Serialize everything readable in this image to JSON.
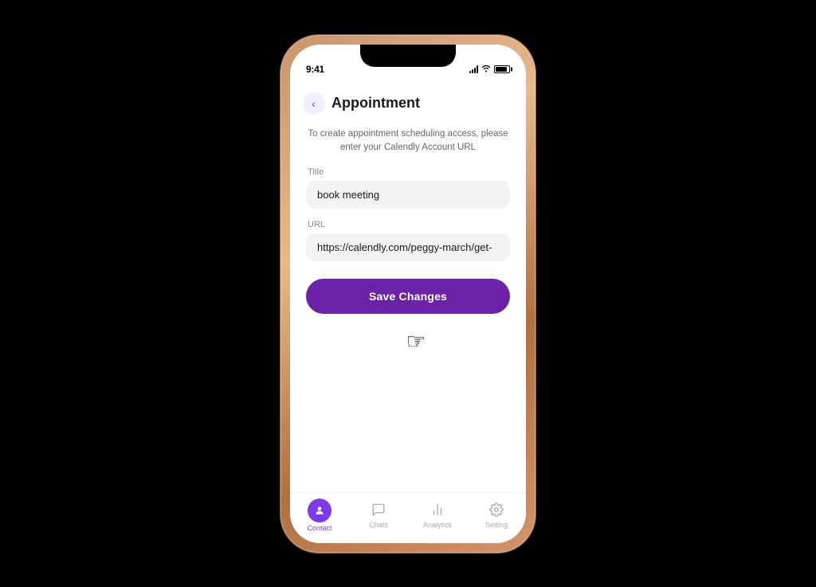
{
  "status_bar": {
    "time": "9:41"
  },
  "header": {
    "back_label": "‹",
    "title": "Appointment"
  },
  "form": {
    "subtitle": "To create appointment scheduling access, please enter your Calendly Account URL",
    "title_label": "Title",
    "title_value": "book meeting",
    "url_label": "URL",
    "url_value": "https://calendly.com/peggy-march/get-"
  },
  "save_button": {
    "label": "Save Changes"
  },
  "bottom_nav": {
    "items": [
      {
        "id": "contact",
        "label": "Contact",
        "active": true
      },
      {
        "id": "chats",
        "label": "Chats",
        "active": false
      },
      {
        "id": "analytics",
        "label": "Analytics",
        "active": false
      },
      {
        "id": "setting",
        "label": "Setting",
        "active": false
      }
    ]
  }
}
